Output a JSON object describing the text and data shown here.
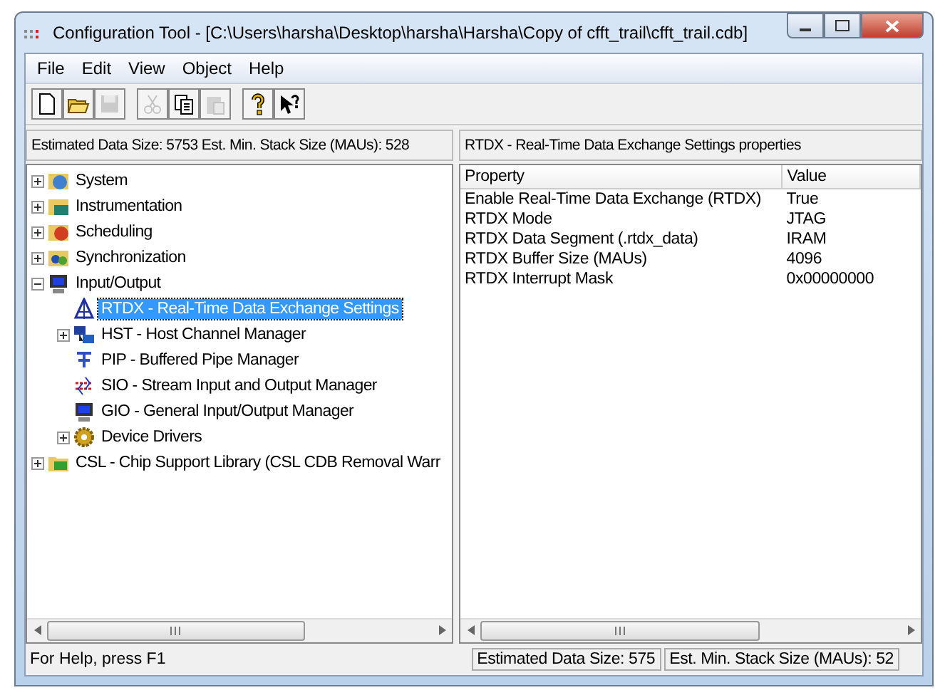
{
  "window": {
    "title": "Configuration Tool - [C:\\Users\\harsha\\Desktop\\harsha\\Harsha\\Copy of cfft_trail\\cfft_trail.cdb]"
  },
  "menu": [
    "File",
    "Edit",
    "View",
    "Object",
    "Help"
  ],
  "toolbar": [
    {
      "kind": "new",
      "disabled": false
    },
    {
      "kind": "open",
      "disabled": false
    },
    {
      "kind": "save",
      "disabled": true
    },
    {
      "kind": "sep"
    },
    {
      "kind": "cut",
      "disabled": true
    },
    {
      "kind": "copy",
      "disabled": false
    },
    {
      "kind": "paste",
      "disabled": true
    },
    {
      "kind": "sep"
    },
    {
      "kind": "help",
      "disabled": false
    },
    {
      "kind": "context-help",
      "disabled": false
    }
  ],
  "tree_header": "Estimated Data Size: 5753   Est. Min. Stack Size (MAUs): 528",
  "tree": [
    {
      "label": "System",
      "kind": "globe",
      "expanded": false,
      "selected": false
    },
    {
      "label": "Instrumentation",
      "kind": "chart",
      "expanded": false,
      "selected": false
    },
    {
      "label": "Scheduling",
      "kind": "clock",
      "expanded": false,
      "selected": false
    },
    {
      "label": "Synchronization",
      "kind": "people",
      "expanded": false,
      "selected": false
    },
    {
      "label": "Input/Output",
      "kind": "monitor",
      "expanded": true,
      "selected": false,
      "children": [
        {
          "label": "RTDX - Real-Time Data Exchange Settings",
          "kind": "antenna",
          "selected": true
        },
        {
          "label": "HST - Host Channel Manager",
          "kind": "network",
          "expanded": false,
          "selected": false
        },
        {
          "label": "PIP - Buffered Pipe Manager",
          "kind": "pipe",
          "selected": false
        },
        {
          "label": "SIO - Stream Input and Output Manager",
          "kind": "arrows",
          "selected": false
        },
        {
          "label": "GIO - General Input/Output Manager",
          "kind": "monitor",
          "selected": false
        },
        {
          "label": "Device Drivers",
          "kind": "gear",
          "expanded": false,
          "selected": false
        }
      ]
    },
    {
      "label": "CSL - Chip Support Library (CSL CDB Removal Warr",
      "kind": "chip",
      "expanded": false,
      "selected": false
    }
  ],
  "properties": {
    "title": "RTDX - Real-Time Data Exchange Settings properties",
    "columns": [
      "Property",
      "Value"
    ],
    "rows": [
      [
        "Enable Real-Time Data Exchange (RTDX)",
        "True"
      ],
      [
        "RTDX Mode",
        "JTAG"
      ],
      [
        "RTDX Data Segment (.rtdx_data)",
        "IRAM"
      ],
      [
        "RTDX Buffer Size (MAUs)",
        "4096"
      ],
      [
        "RTDX Interrupt Mask",
        "0x00000000"
      ]
    ]
  },
  "status_bar": {
    "help": "For Help, press F1",
    "panels": [
      "Estimated Data Size: 575",
      "Est. Min. Stack Size (MAUs): 52"
    ]
  }
}
